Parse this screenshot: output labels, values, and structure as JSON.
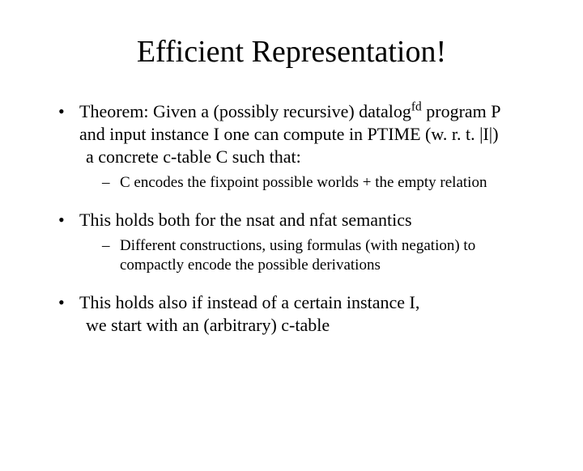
{
  "title": "Efficient Representation!",
  "b1": {
    "p1a": "Theorem: Given a (possibly recursive) datalog",
    "p1sup": "fd",
    "p1b": " program P",
    "p2": "and input instance I one can compute in PTIME (w. r. t. |I|)",
    "p3": " a concrete c-table C such that:",
    "sub1": "C encodes the fixpoint possible worlds + the empty relation"
  },
  "b2": {
    "p1": "This holds both for the nsat and nfat semantics",
    "sub1": "Different constructions, using formulas (with negation) to compactly encode the possible derivations"
  },
  "b3": {
    "p1": "This holds also if instead of a certain instance I,",
    "p2": " we start with an (arbitrary) c-table"
  }
}
